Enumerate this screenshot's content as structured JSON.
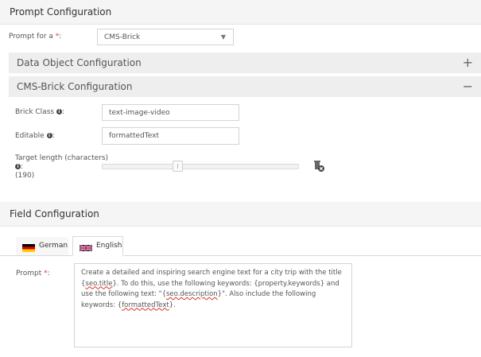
{
  "prompt_config": {
    "title": "Prompt Configuration",
    "prompt_for_label": "Prompt for a",
    "prompt_for_required": "*",
    "prompt_for_colon": ":",
    "prompt_for_value": "CMS-Brick"
  },
  "panels": {
    "data_object": {
      "title": "Data Object Configuration",
      "tool": "+"
    },
    "cms_brick": {
      "title": "CMS-Brick Configuration",
      "tool": "−"
    }
  },
  "cms_brick": {
    "brick_class_label": "Brick Class",
    "brick_class_value": "text-image-video",
    "editable_label": "Editable",
    "editable_value": "formattedText",
    "target_length_label": "Target length (characters)",
    "target_length_value": "(190)",
    "colon": ":",
    "target_length_fraction": 0.38
  },
  "field_config": {
    "title": "Field Configuration",
    "tabs": [
      {
        "label": "German",
        "active": false
      },
      {
        "label": "English",
        "active": true
      }
    ],
    "prompt_label": "Prompt",
    "prompt_required": "*",
    "prompt_colon": ":",
    "prompt_text": {
      "p1": "Create a detailed and inspiring search engine text for a city trip with the title {",
      "s1": "seo.title",
      "p2": "}. To do this, use the following keywords: {property.keywords} and use the following text: \"{",
      "s2": "seo.description",
      "p3": "}\". Also include the following keywords: {",
      "s3": "formattedText",
      "p4": "}."
    }
  },
  "icons": {
    "dropdown": "chevron-down-icon",
    "info": "info-icon",
    "reset": "trash-reset-icon"
  },
  "colors": {
    "required": "#e53935",
    "panel_bg": "#eeeeee",
    "section_bg": "#f5f5f5"
  }
}
